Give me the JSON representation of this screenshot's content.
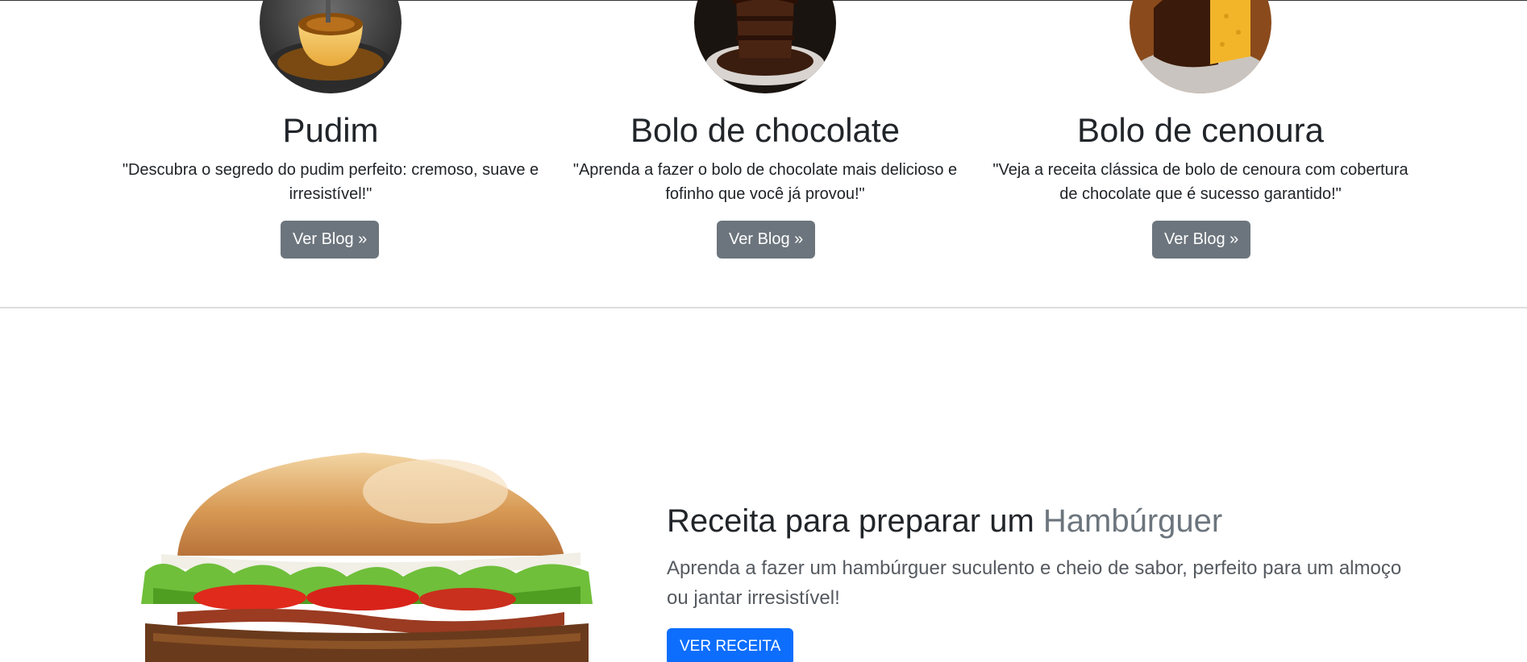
{
  "cards": [
    {
      "image": "pudim-photo",
      "title": "Pudim",
      "text": "\"Descubra o segredo do pudim perfeito: cremoso, suave e irresistível!\"",
      "button": "Ver Blog »"
    },
    {
      "image": "bolo-chocolate-photo",
      "title": "Bolo de chocolate",
      "text": "\"Aprenda a fazer o bolo de chocolate mais delicioso e fofinho que você já provou!\"",
      "button": "Ver Blog »"
    },
    {
      "image": "bolo-cenoura-photo",
      "title": "Bolo de cenoura",
      "text": "\"Veja a receita clássica de bolo de cenoura com cobertura de chocolate que é sucesso garantido!\"",
      "button": "Ver Blog »"
    }
  ],
  "feature": {
    "image": "hamburger-photo",
    "title_main": "Receita para preparar um ",
    "title_muted": "Hambúrguer",
    "lead": "Aprenda a fazer um hambúrguer suculento e cheio de sabor, perfeito para um almoço ou jantar irresistível!",
    "button": "VER RECEITA"
  },
  "colors": {
    "secondary_button": "#6c757d",
    "primary_button": "#0d6efd",
    "text": "#212529",
    "muted_text": "#6c757d"
  }
}
